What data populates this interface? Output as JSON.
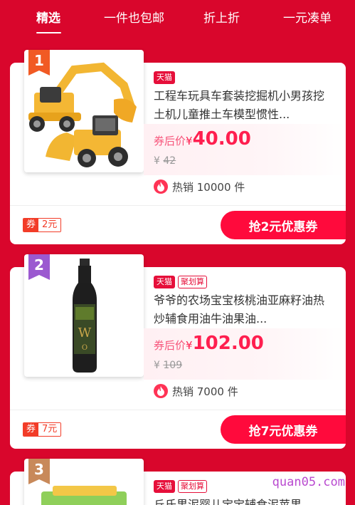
{
  "tabs": [
    {
      "label": "精选",
      "active": true
    },
    {
      "label": "一件也包邮",
      "active": false
    },
    {
      "label": "折上折",
      "active": false
    },
    {
      "label": "一元凑单",
      "active": false
    }
  ],
  "products": [
    {
      "rank": "1",
      "rank_color": "#f15a24",
      "image": "toy-excavator-image",
      "badges": [
        "天猫"
      ],
      "title": "工程车玩具车套装挖掘机小男孩挖土机儿童推土车模型惯性...",
      "price_label": "券后价",
      "currency": "¥",
      "price": "40.00",
      "original_price_prefix": "¥",
      "original_price": "42",
      "sales": "热销 10000 件",
      "coupon_prefix": "券",
      "coupon_amount": "2元",
      "coupon_button": "抢2元优惠券"
    },
    {
      "rank": "2",
      "rank_color": "#9b59d0",
      "image": "walnut-oil-bottle-image",
      "badges": [
        "天猫",
        "聚划算"
      ],
      "title": "爷爷的农场宝宝核桃油亚麻籽油热炒辅食用油牛油果油...",
      "price_label": "券后价",
      "currency": "¥",
      "price": "102.00",
      "original_price_prefix": "¥",
      "original_price": "109",
      "sales": "热销 7000 件",
      "coupon_prefix": "券",
      "coupon_amount": "7元",
      "coupon_button": "抢7元优惠券"
    },
    {
      "rank": "3",
      "rank_color": "#c8895a",
      "image": "baby-food-box-image",
      "badges": [
        "天猫",
        "聚划算"
      ],
      "title": "丘氏果泥婴儿宝宝辅食泥苹果..."
    }
  ],
  "watermark": "quan05.com"
}
